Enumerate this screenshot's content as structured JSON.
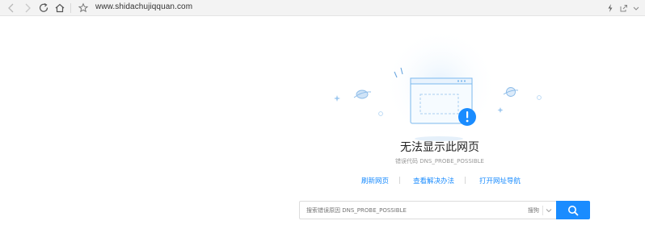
{
  "browser": {
    "url": "www.shidachujiqquan.com",
    "icons": [
      "back-icon",
      "forward-icon",
      "reload-icon",
      "home-icon",
      "star-icon",
      "lightning-icon",
      "share-icon",
      "more-icon"
    ]
  },
  "error_page": {
    "title": "无法显示此网页",
    "code_line": "错误代码 DNS_PROBE_POSSIBLE",
    "links": [
      {
        "label": "刷新网页"
      },
      {
        "label": "查看解决办法"
      },
      {
        "label": "打开网址导航"
      }
    ]
  },
  "search": {
    "placeholder": "搜索错误原因 DNS_PROBE_POSSIBLE",
    "engine": "搜狗"
  },
  "colors": {
    "accent": "#1a8cff",
    "toolbar_bg": "#f3f3f3",
    "title": "#222222"
  }
}
